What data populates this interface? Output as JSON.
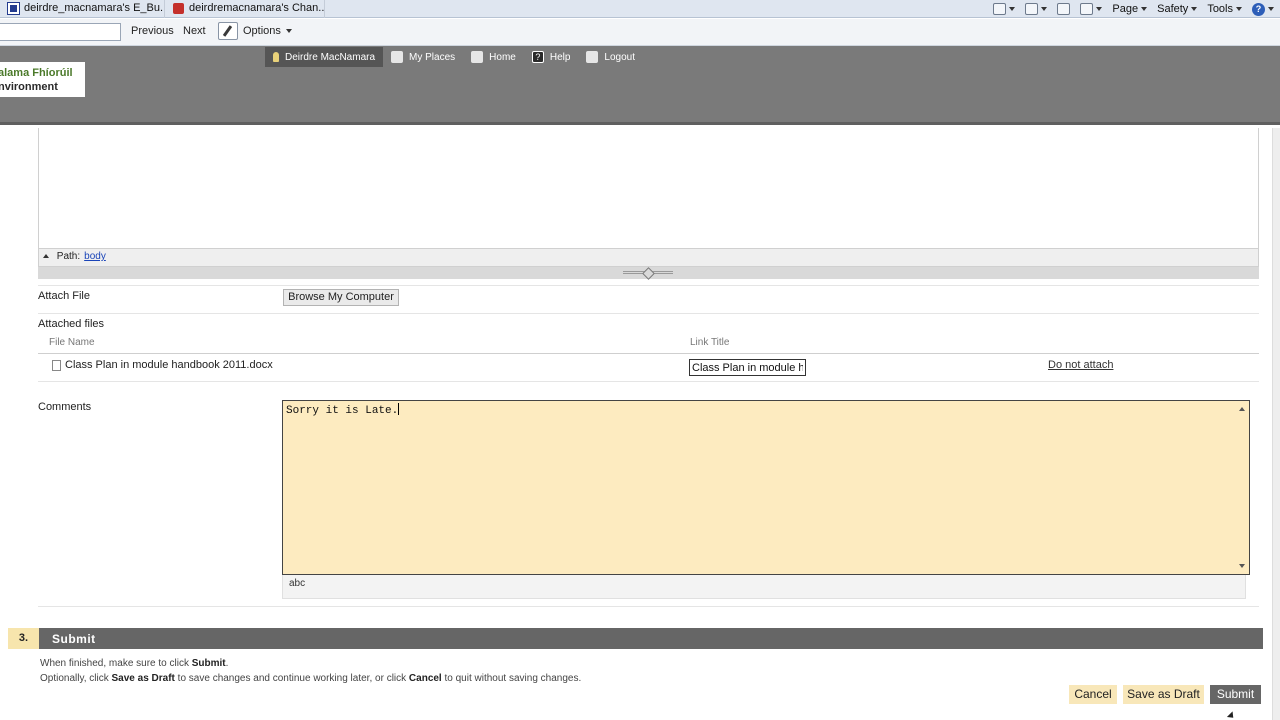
{
  "browser": {
    "tabs": [
      {
        "label": "deirdre_macnamara's E_Bu..."
      },
      {
        "label": "deirdremacnamara's Chan..."
      }
    ],
    "commands": {
      "page": "Page",
      "safety": "Safety",
      "tools": "Tools"
    }
  },
  "findbar": {
    "previous": "Previous",
    "next": "Next",
    "options": "Options"
  },
  "header": {
    "logo_line1": "alama Fhíorúil",
    "logo_line2": "nvironment",
    "nav": {
      "user": "Deirdre MacNamara",
      "my_places": "My Places",
      "home": "Home",
      "help": "Help",
      "logout": "Logout"
    }
  },
  "editor": {
    "path_label": "Path:",
    "path_value": "body"
  },
  "attach": {
    "label": "Attach File",
    "browse_button": "Browse My Computer",
    "attached_label": "Attached files",
    "columns": {
      "file_name": "File Name",
      "link_title": "Link Title"
    },
    "files": [
      {
        "name": "Class Plan in module handbook 2011.docx",
        "link_title": "Class Plan in module h",
        "action": "Do not attach"
      }
    ]
  },
  "comments": {
    "label": "Comments",
    "value": "Sorry it is Late.",
    "spell_icon": "abc"
  },
  "submit_section": {
    "number": "3.",
    "title": "Submit",
    "instr1_prefix": "When finished, make sure to click ",
    "instr1_bold": "Submit",
    "instr1_suffix": ".",
    "instr2_a": "Optionally, click ",
    "instr2_b": "Save as Draft",
    "instr2_c": " to save changes and continue working later, or click ",
    "instr2_d": "Cancel",
    "instr2_e": " to quit without saving changes."
  },
  "buttons": {
    "cancel": "Cancel",
    "save_draft": "Save as Draft",
    "submit": "Submit"
  }
}
